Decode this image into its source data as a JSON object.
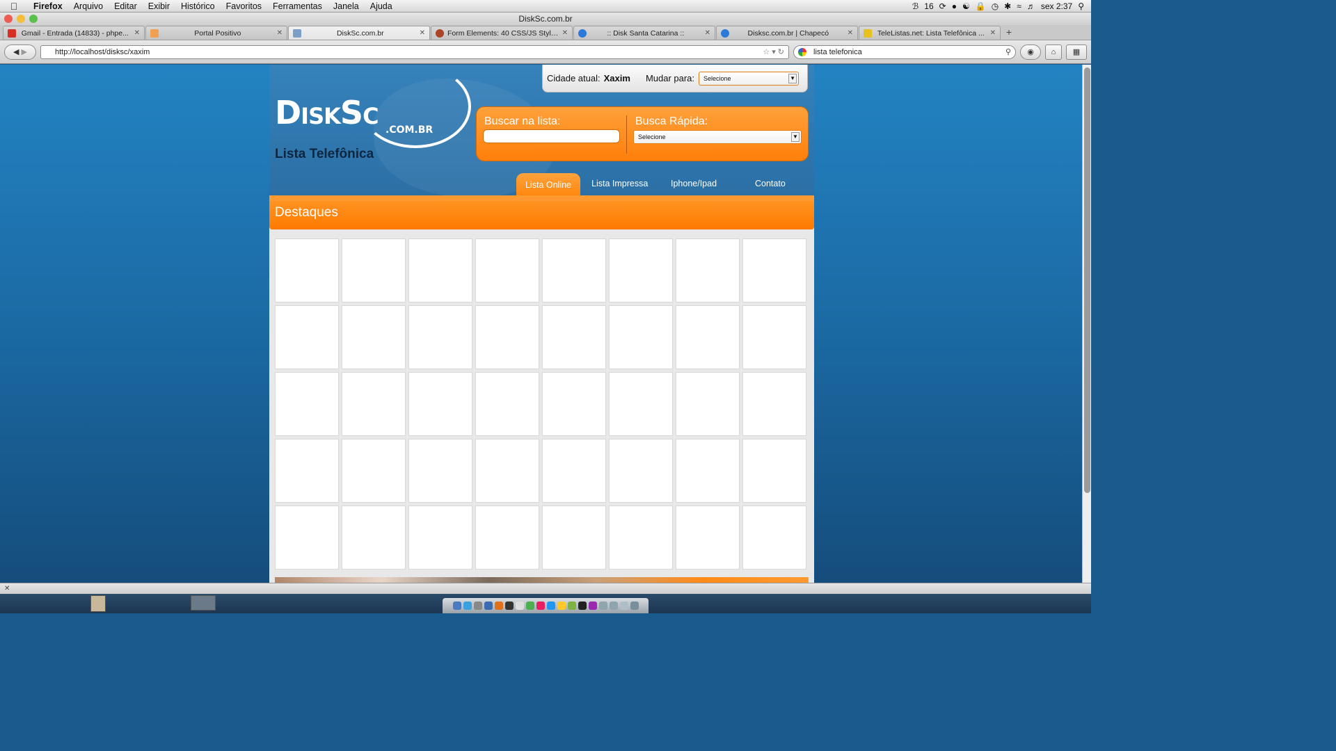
{
  "menubar": {
    "app": "Firefox",
    "items": [
      "Arquivo",
      "Editar",
      "Exibir",
      "Histórico",
      "Favoritos",
      "Ferramentas",
      "Janela",
      "Ajuda"
    ],
    "battery_count": "16",
    "clock": "sex 2:37"
  },
  "window": {
    "title": "DiskSc.com.br"
  },
  "tabs": [
    {
      "label": "Gmail - Entrada (14833) - phpe...",
      "color": "#d93025"
    },
    {
      "label": "Portal Positivo",
      "color": "#f0a050"
    },
    {
      "label": "DiskSc.com.br",
      "color": "#7aa0c8"
    },
    {
      "label": "Form Elements: 40 CSS/JS Stylin...",
      "color": "#aa4422"
    },
    {
      "label": ":: Disk Santa Catarina ::",
      "color": "#2c7ad8"
    },
    {
      "label": "Disksc.com.br | Chapecó",
      "color": "#2c7ad8"
    },
    {
      "label": "TeleListas.net: Lista Telefônica ...",
      "color": "#222222"
    }
  ],
  "navbar": {
    "url": "http://localhost/disksc/xaxim",
    "search_value": "lista telefonica"
  },
  "site": {
    "logo_main": "DiskSc",
    "logo_sub": ".COM.BR",
    "subtitle": "Lista Telefônica",
    "city_label": "Cidade atual:",
    "city_value": "Xaxim",
    "change_label": "Mudar para:",
    "change_select": "Selecione",
    "search_label": "Buscar na lista:",
    "search_value": "",
    "quick_label": "Busca Rápida:",
    "quick_select": "Selecione",
    "nav": [
      "Lista Online",
      "Lista Impressa",
      "Iphone/Ipad",
      "Contato"
    ],
    "active_nav": "Lista Online",
    "section_title": "Destaques",
    "grid_rows": 5,
    "grid_cols": 8
  },
  "colors": {
    "accent_orange": "#ff7f0a",
    "header_blue": "#2b6fa5",
    "page_bg_blue": "#1b6aa4"
  }
}
